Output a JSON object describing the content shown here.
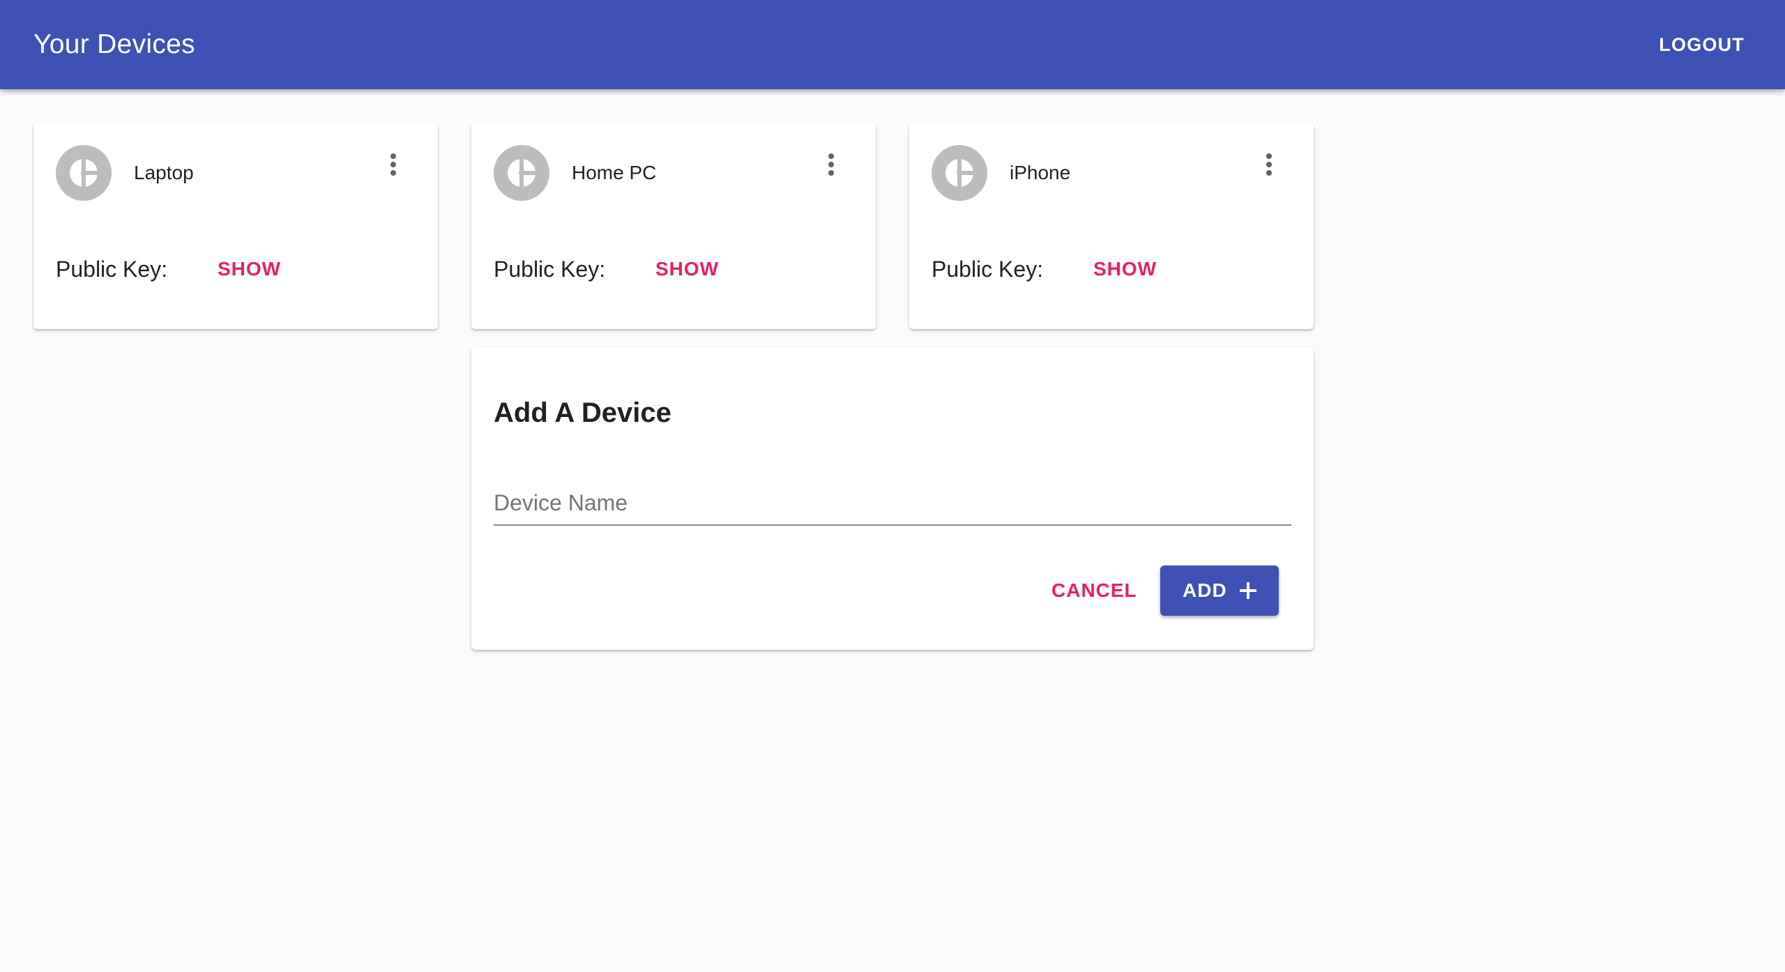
{
  "appbar": {
    "title": "Your Devices",
    "logout_label": "LOGOUT"
  },
  "devices": [
    {
      "name": "Laptop",
      "public_key_label": "Public Key:",
      "show_label": "SHOW",
      "icon": "device-icon",
      "menu_icon": "more-vert-icon"
    },
    {
      "name": "Home PC",
      "public_key_label": "Public Key:",
      "show_label": "SHOW",
      "icon": "device-icon",
      "menu_icon": "more-vert-icon"
    },
    {
      "name": "iPhone",
      "public_key_label": "Public Key:",
      "show_label": "SHOW",
      "icon": "device-icon",
      "menu_icon": "more-vert-icon"
    }
  ],
  "add_device": {
    "title": "Add A Device",
    "input_placeholder": "Device Name",
    "input_value": "",
    "cancel_label": "CANCEL",
    "add_label": "ADD",
    "add_icon": "plus-icon"
  },
  "colors": {
    "primary": "#3f51b5",
    "accent": "#e91e63",
    "background": "#fafafa",
    "avatar": "#bdbdbd"
  }
}
